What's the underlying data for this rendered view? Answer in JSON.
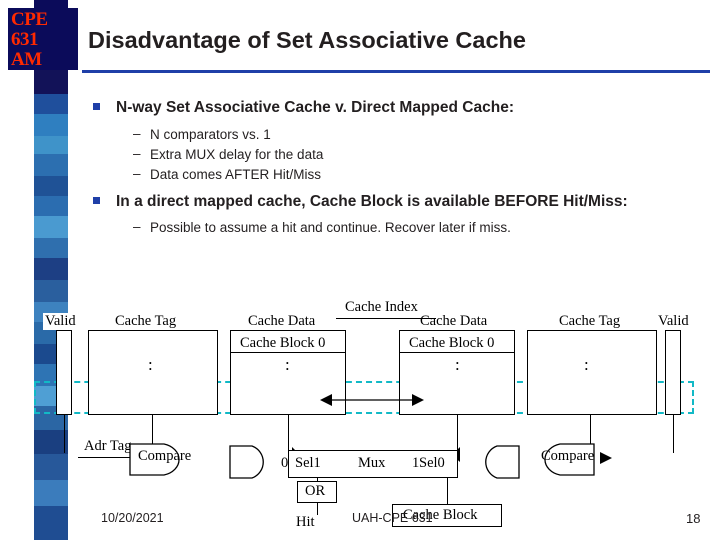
{
  "logo": {
    "line1": "CPE",
    "line2": "631",
    "line3": "AM"
  },
  "title": "Disadvantage of Set Associative Cache",
  "bullets": [
    {
      "text": "N-way Set Associative Cache v. Direct Mapped Cache:",
      "subs": [
        "N comparators vs. 1",
        "Extra MUX delay for the data",
        "Data comes AFTER Hit/Miss"
      ]
    },
    {
      "text": "In a direct mapped cache, Cache Block is available BEFORE Hit/Miss:",
      "subs": [
        "Possible to assume a hit and continue.  Recover later if miss."
      ]
    }
  ],
  "diagram": {
    "cache_index": "Cache Index",
    "valid_left": "Valid",
    "cache_tag_left": "Cache Tag",
    "cache_data_left": "Cache Data",
    "cache_block_left": "Cache Block 0",
    "cache_data_right": "Cache Data",
    "cache_block_right": "Cache Block 0",
    "cache_tag_right": "Cache Tag",
    "valid_right": "Valid",
    "adr_tag": "Adr Tag",
    "compare_left": "Compare",
    "compare_right": "Compare",
    "sel1": "Sel1",
    "mux": "Mux",
    "sel0": "Sel0",
    "mux_digit_1": "1",
    "mux_digit_0": "0",
    "or_gate": "OR",
    "hit": "Hit",
    "cache_block": "Cache Block",
    "dots": ":"
  },
  "footer": {
    "date": "10/20/2021",
    "center": "UAH-CPE 631",
    "page": "18"
  },
  "colors": {
    "accent_rule": "#1f3fa8",
    "dashed_highlight": "#12b9c6",
    "logo_bg": "#0b0b5a",
    "logo_fg": "#ff2a00"
  }
}
